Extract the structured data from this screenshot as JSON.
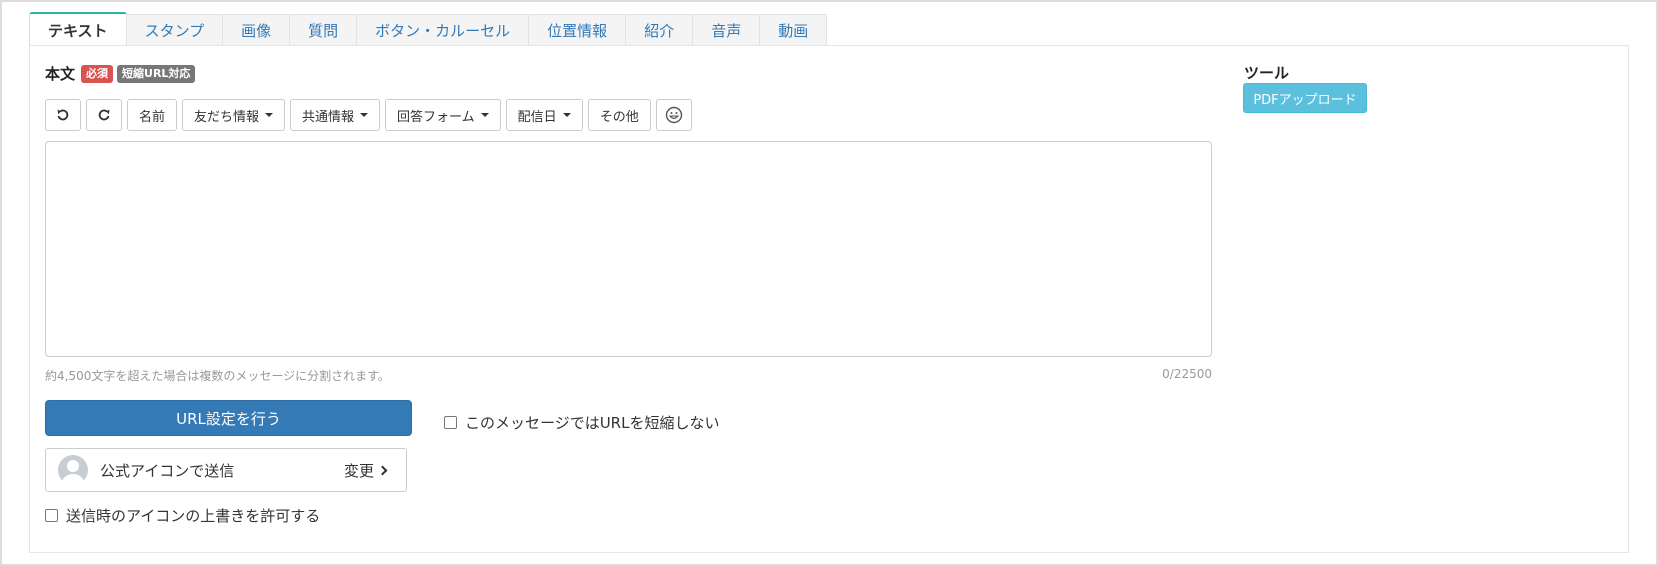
{
  "tabs": [
    {
      "label": "テキスト",
      "active": true
    },
    {
      "label": "スタンプ"
    },
    {
      "label": "画像"
    },
    {
      "label": "質問"
    },
    {
      "label": "ボタン・カルーセル"
    },
    {
      "label": "位置情報"
    },
    {
      "label": "紹介"
    },
    {
      "label": "音声"
    },
    {
      "label": "動画"
    }
  ],
  "body_section": {
    "title": "本文",
    "badge_required": "必須",
    "badge_short_url": "短縮URL対応"
  },
  "toolbar": {
    "undo_icon": "undo-icon",
    "redo_icon": "redo-icon",
    "name": "名前",
    "friend_info": "友だち情報",
    "shared_info": "共通情報",
    "answer_form": "回答フォーム",
    "delivery_date": "配信日",
    "other": "その他",
    "emoji_icon": "emoji-icon"
  },
  "editor": {
    "value": "",
    "hint": "約4,500文字を超えた場合は複数のメッセージに分割されます。",
    "counter": "0/22500"
  },
  "url_settings_button": "URL設定を行う",
  "no_shorten_checkbox": {
    "label": "このメッセージではURLを短縮しない",
    "checked": false
  },
  "sender_icon": {
    "label": "公式アイコンで送信",
    "change_label": "変更"
  },
  "allow_icon_override_checkbox": {
    "label": "送信時のアイコンの上書きを許可する",
    "checked": false
  },
  "tools": {
    "title": "ツール",
    "pdf_upload": "PDFアップロード"
  },
  "colors": {
    "primary": "#337ab7",
    "info": "#5bc0de",
    "danger": "#d9534f",
    "badge_gray": "#777777",
    "active_tab_accent": "#2bb5a0"
  }
}
